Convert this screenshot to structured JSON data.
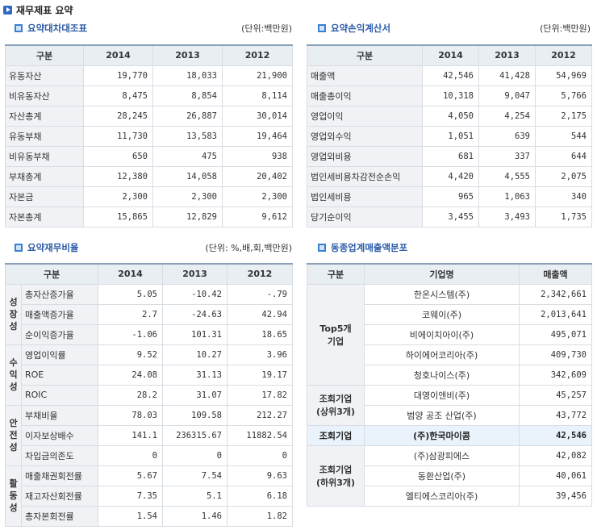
{
  "main_title": "재무제표 요약",
  "balance": {
    "title": "요약대차대조표",
    "unit": "(단위:백만원)",
    "headers": [
      "구분",
      "2014",
      "2013",
      "2012"
    ],
    "rows": [
      [
        "유동자산",
        "19,770",
        "18,033",
        "21,900"
      ],
      [
        "비유동자산",
        "8,475",
        "8,854",
        "8,114"
      ],
      [
        "자산총계",
        "28,245",
        "26,887",
        "30,014"
      ],
      [
        "유동부채",
        "11,730",
        "13,583",
        "19,464"
      ],
      [
        "비유동부채",
        "650",
        "475",
        "938"
      ],
      [
        "부채총계",
        "12,380",
        "14,058",
        "20,402"
      ],
      [
        "자본금",
        "2,300",
        "2,300",
        "2,300"
      ],
      [
        "자본총계",
        "15,865",
        "12,829",
        "9,612"
      ]
    ]
  },
  "income": {
    "title": "요약손익계산서",
    "unit": "(단위:백만원)",
    "headers": [
      "구분",
      "2014",
      "2013",
      "2012"
    ],
    "rows": [
      [
        "매출액",
        "42,546",
        "41,428",
        "54,969"
      ],
      [
        "매출총이익",
        "10,318",
        "9,047",
        "5,766"
      ],
      [
        "영업이익",
        "4,050",
        "4,254",
        "2,175"
      ],
      [
        "영업외수익",
        "1,051",
        "639",
        "544"
      ],
      [
        "영업외비용",
        "681",
        "337",
        "644"
      ],
      [
        "법인세비용차감전순손익",
        "4,420",
        "4,555",
        "2,075"
      ],
      [
        "법인세비용",
        "965",
        "1,063",
        "340"
      ],
      [
        "당기순이익",
        "3,455",
        "3,493",
        "1,735"
      ]
    ]
  },
  "ratio": {
    "title": "요약재무비율",
    "unit": "(단위: %,배,회,백만원)",
    "headers": [
      "구분",
      "2014",
      "2013",
      "2012"
    ],
    "groups": [
      {
        "label": [
          "성",
          "장",
          "성"
        ],
        "rows": [
          [
            "총자산증가율",
            "5.05",
            "-10.42",
            "-.79"
          ],
          [
            "매출액증가율",
            "2.7",
            "-24.63",
            "42.94"
          ],
          [
            "순이익증가율",
            "-1.06",
            "101.31",
            "18.65"
          ]
        ]
      },
      {
        "label": [
          "수",
          "익",
          "성"
        ],
        "rows": [
          [
            "영업이익률",
            "9.52",
            "10.27",
            "3.96"
          ],
          [
            "ROE",
            "24.08",
            "31.13",
            "19.17"
          ],
          [
            "ROIC",
            "28.2",
            "31.07",
            "17.82"
          ]
        ]
      },
      {
        "label": [
          "안",
          "전",
          "성"
        ],
        "rows": [
          [
            "부채비율",
            "78.03",
            "109.58",
            "212.27"
          ],
          [
            "이자보상배수",
            "141.1",
            "236315.67",
            "11882.54"
          ],
          [
            "차입금의존도",
            "0",
            "0",
            "0"
          ]
        ]
      },
      {
        "label": [
          "활",
          "동",
          "성"
        ],
        "rows": [
          [
            "매출채권회전률",
            "5.67",
            "7.54",
            "9.63"
          ],
          [
            "재고자산회전률",
            "7.35",
            "5.1",
            "6.18"
          ],
          [
            "총자본회전률",
            "1.54",
            "1.46",
            "1.82"
          ]
        ]
      }
    ]
  },
  "industry": {
    "title": "동종업계매출액분포",
    "headers": [
      "구분",
      "기업명",
      "매출액"
    ],
    "groups": [
      {
        "label": [
          "Top5개",
          "기업"
        ],
        "rows": [
          [
            "한온시스템(주)",
            "2,342,661"
          ],
          [
            "코웨이(주)",
            "2,013,641"
          ],
          [
            "비에이치아이(주)",
            "495,071"
          ],
          [
            "하이에어코리아(주)",
            "409,730"
          ],
          [
            "청호나이스(주)",
            "342,609"
          ]
        ]
      },
      {
        "label": [
          "조회기업",
          "(상위3개)"
        ],
        "rows": [
          [
            "대영이앤비(주)",
            "45,257"
          ],
          [
            "범양 공조 산업(주)",
            "43,772"
          ]
        ]
      },
      {
        "label": [
          "조회기업"
        ],
        "highlight": true,
        "rows": [
          [
            "(주)한국마이콤",
            "42,546"
          ]
        ]
      },
      {
        "label": [
          "조회기업",
          "(하위3개)"
        ],
        "rows": [
          [
            "(주)삼광피에스",
            "42,082"
          ],
          [
            "동환산업(주)",
            "40,061"
          ],
          [
            "엘티에스코리아(주)",
            "39,456"
          ]
        ]
      }
    ]
  }
}
